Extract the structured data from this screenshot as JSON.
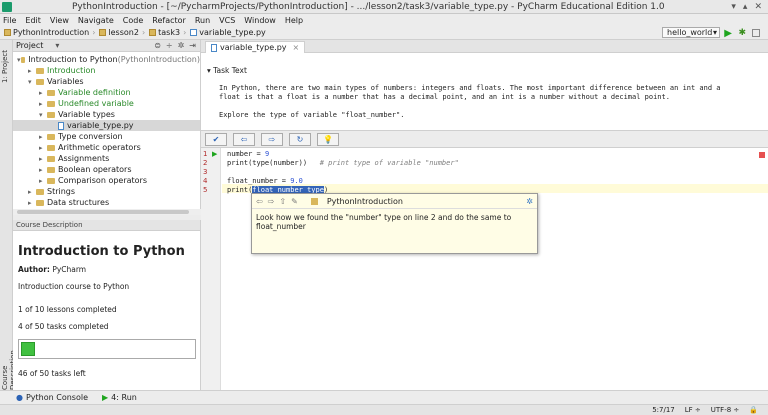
{
  "window": {
    "title": "PythonIntroduction - [~/PycharmProjects/PythonIntroduction] - .../lesson2/task3/variable_type.py - PyCharm Educational Edition 1.0"
  },
  "menu": [
    "File",
    "Edit",
    "View",
    "Navigate",
    "Code",
    "Refactor",
    "Run",
    "VCS",
    "Window",
    "Help"
  ],
  "breadcrumb": [
    "PythonIntroduction",
    "lesson2",
    "task3",
    "variable_type.py"
  ],
  "run_config": "hello_world",
  "side_tabs": {
    "project": "1: Project",
    "course": "Course Description"
  },
  "project_panel": {
    "title": "Project",
    "tree": [
      {
        "label": "Introduction to Python",
        "suffix": " (PythonIntroduction)",
        "level": 0,
        "arrow": "▾",
        "kind": "folder",
        "color": "normal"
      },
      {
        "label": "Introduction",
        "level": 1,
        "arrow": "▸",
        "kind": "folder",
        "color": "green"
      },
      {
        "label": "Variables",
        "level": 1,
        "arrow": "▾",
        "kind": "folder",
        "color": "normal"
      },
      {
        "label": "Variable definition",
        "level": 2,
        "arrow": "▸",
        "kind": "folder",
        "color": "green"
      },
      {
        "label": "Undefined variable",
        "level": 2,
        "arrow": "▸",
        "kind": "folder",
        "color": "green"
      },
      {
        "label": "Variable types",
        "level": 2,
        "arrow": "▾",
        "kind": "folder",
        "color": "normal"
      },
      {
        "label": "variable_type.py",
        "level": 3,
        "arrow": "",
        "kind": "file",
        "color": "normal",
        "selected": true
      },
      {
        "label": "Type conversion",
        "level": 2,
        "arrow": "▸",
        "kind": "folder",
        "color": "normal"
      },
      {
        "label": "Arithmetic operators",
        "level": 2,
        "arrow": "▸",
        "kind": "folder",
        "color": "normal"
      },
      {
        "label": "Assignments",
        "level": 2,
        "arrow": "▸",
        "kind": "folder",
        "color": "normal"
      },
      {
        "label": "Boolean operators",
        "level": 2,
        "arrow": "▸",
        "kind": "folder",
        "color": "normal"
      },
      {
        "label": "Comparison operators",
        "level": 2,
        "arrow": "▸",
        "kind": "folder",
        "color": "normal"
      },
      {
        "label": "Strings",
        "level": 1,
        "arrow": "▸",
        "kind": "folder",
        "color": "normal"
      },
      {
        "label": "Data structures",
        "level": 1,
        "arrow": "▸",
        "kind": "folder",
        "color": "normal"
      }
    ]
  },
  "course": {
    "header": "Course Description",
    "title": "Introduction to Python",
    "author_label": "Author:",
    "author": "PyCharm",
    "description": "Introduction course to Python",
    "lessons": "1 of 10 lessons completed",
    "tasks": "4 of 50 tasks completed",
    "progress": 0.08,
    "tasks_left": "46 of 50 tasks left"
  },
  "editor_tab": "variable_type.py",
  "task": {
    "heading": "Task Text",
    "body": "In Python, there are two main types of numbers: integers and floats. The most important difference between an int and a\nfloat is that a float is a number that has a decimal point, and an int is a number without a decimal point.\n\nExplore the type of variable \"float_number\"."
  },
  "code": {
    "line_numbers": [
      "1",
      "2",
      "3",
      "4",
      "5"
    ],
    "l1a": "number = ",
    "l1b": "9",
    "l2a": "print(type(number))   ",
    "l2b": "# print type of variable \"number\"",
    "l4a": "float_number = ",
    "l4b": "9.0",
    "l5a": "print(",
    "l5b": "float number type",
    "l5c": ")"
  },
  "hint": {
    "project": "PythonIntroduction",
    "text": "Look how we found the \"number\" type on line 2 and do the same to float_number"
  },
  "status": {
    "console": "Python Console",
    "run": "4: Run",
    "position": "5:7/17",
    "line_sep": "LF ÷",
    "encoding": "UTF-8 ÷"
  }
}
